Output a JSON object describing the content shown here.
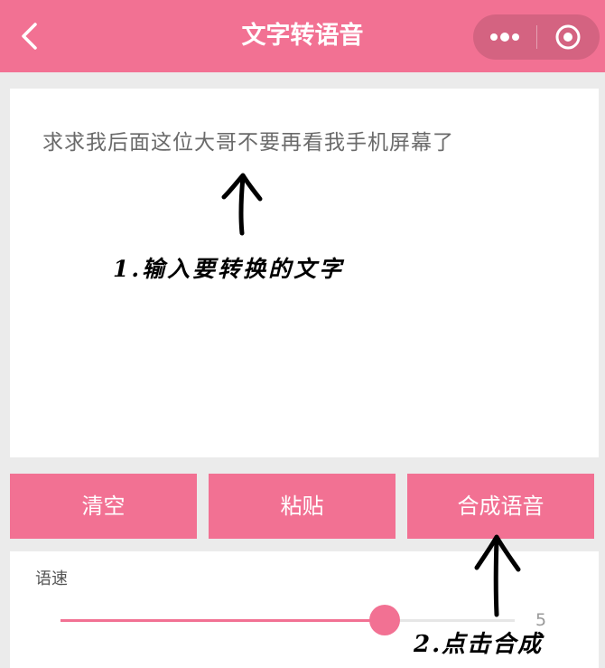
{
  "header": {
    "title": "文字转语音",
    "back_icon": "chevron-left-icon",
    "more_icon": "more-dots-icon",
    "close_icon": "record-close-icon",
    "color": "#f27193"
  },
  "editor": {
    "text": "求求我后面这位大哥不要再看我手机屏幕了"
  },
  "annotations": {
    "step1": "1.输入要转换的文字",
    "step2": "2.点击合成"
  },
  "buttons": {
    "clear": "清空",
    "paste": "粘贴",
    "synthesize": "合成语音"
  },
  "speed": {
    "label": "语速",
    "value": "5",
    "value_num": 5,
    "min": 0,
    "max": 7
  },
  "colors": {
    "accent": "#f27193",
    "background": "#ebebeb"
  }
}
